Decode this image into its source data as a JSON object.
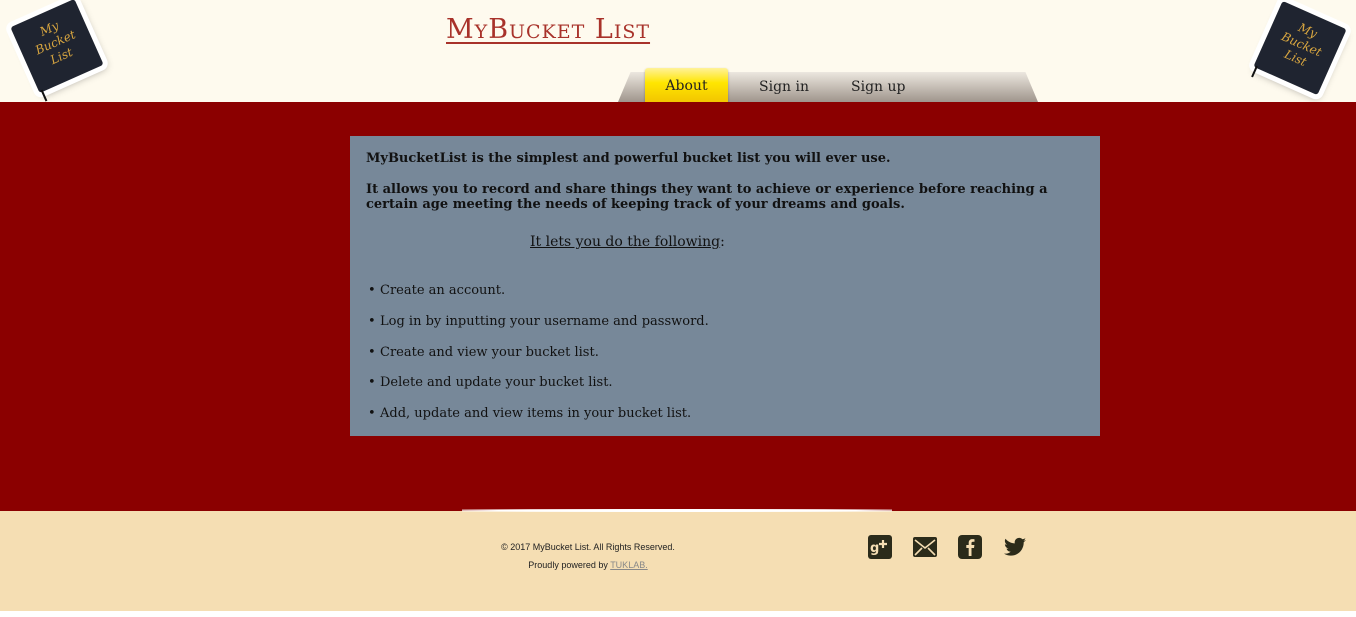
{
  "header": {
    "title": "MyBucket List",
    "logo_text": [
      "My",
      "Bucket",
      "List"
    ]
  },
  "nav": {
    "items": [
      {
        "label": "About",
        "active": true
      },
      {
        "label": "Sign in",
        "active": false
      },
      {
        "label": "Sign up",
        "active": false
      }
    ]
  },
  "about": {
    "intro": "MyBucketList is the simplest and powerful bucket list you will ever use.",
    "description": "It allows you to record and share things they want to achieve or experience before reaching a certain age meeting the needs of keeping track of your dreams and goals.",
    "features_heading": "It lets you do the following",
    "features_heading_suffix": ":",
    "features": [
      "Create an account.",
      "Log in by inputting your username and password.",
      "Create and view your bucket list.",
      "Delete and update your bucket list.",
      "Add, update and view items in your bucket list."
    ]
  },
  "footer": {
    "copyright": "© 2017 MyBucket List. All Rights Reserved.",
    "powered_prefix": "Proudly powered by",
    "powered_link": "TUKLAB."
  },
  "social": [
    "google-plus-icon",
    "mail-icon",
    "facebook-icon",
    "twitter-icon"
  ],
  "colors": {
    "header_bg": "#fefaee",
    "main_bg": "#8b0000",
    "content_bg": "#778899",
    "footer_bg": "#f5deb3",
    "title": "#a8322a",
    "active_tab": "#ffe600"
  }
}
